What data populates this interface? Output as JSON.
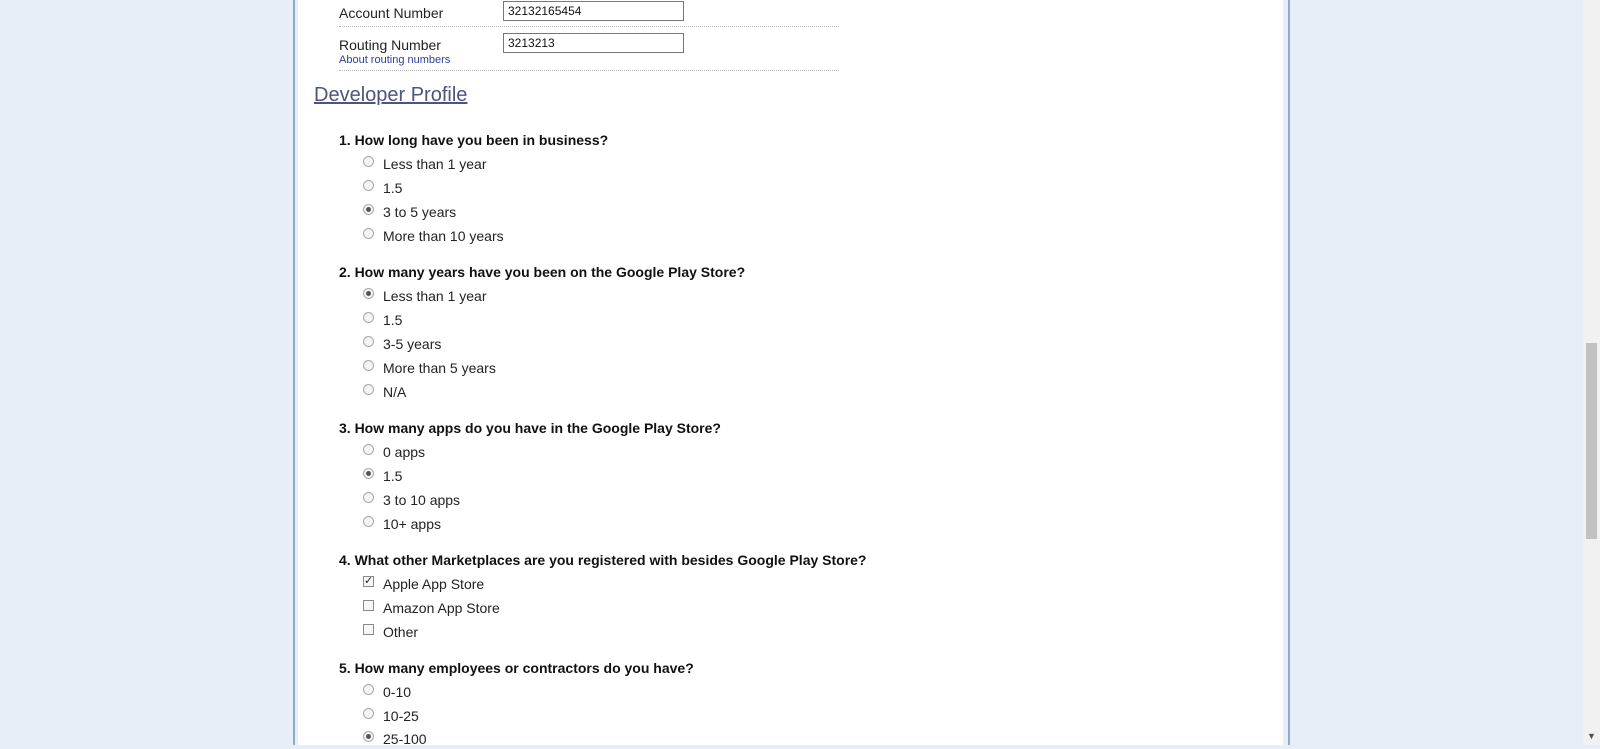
{
  "billing": {
    "account_number": {
      "label": "Account Number",
      "value": "32132165454"
    },
    "routing_number": {
      "label": "Routing Number",
      "value": "3213213",
      "help_link": "About routing numbers"
    }
  },
  "section": {
    "title": "Developer Profile"
  },
  "questions": [
    {
      "text": "1. How long have you been in business?",
      "type": "radio",
      "options": [
        {
          "label": "Less than 1 year",
          "checked": false
        },
        {
          "label": "1.5",
          "checked": false
        },
        {
          "label": "3 to 5 years",
          "checked": true
        },
        {
          "label": "More than 10 years",
          "checked": false
        }
      ]
    },
    {
      "text": "2. How many years have you been on the Google Play Store?",
      "type": "radio",
      "options": [
        {
          "label": "Less than 1 year",
          "checked": true
        },
        {
          "label": "1.5",
          "checked": false
        },
        {
          "label": "3-5 years",
          "checked": false
        },
        {
          "label": "More than 5 years",
          "checked": false
        },
        {
          "label": "N/A",
          "checked": false
        }
      ]
    },
    {
      "text": "3. How many apps do you have in the Google Play Store?",
      "type": "radio",
      "options": [
        {
          "label": "0 apps",
          "checked": false
        },
        {
          "label": "1.5",
          "checked": true
        },
        {
          "label": "3 to 10 apps",
          "checked": false
        },
        {
          "label": "10+ apps",
          "checked": false
        }
      ]
    },
    {
      "text": "4. What other Marketplaces are you registered with besides Google Play Store?",
      "type": "checkbox",
      "options": [
        {
          "label": "Apple App Store",
          "checked": true
        },
        {
          "label": "Amazon App Store",
          "checked": false
        },
        {
          "label": "Other",
          "checked": false
        }
      ]
    },
    {
      "text": "5. How many employees or contractors do you have?",
      "type": "radio",
      "options": [
        {
          "label": "0-10",
          "checked": false
        },
        {
          "label": "10-25",
          "checked": false
        },
        {
          "label": "25-100",
          "checked": true
        }
      ]
    }
  ],
  "colors": {
    "page_bg": "#e7eef8",
    "panel_border": "#8fa9cf",
    "section_title": "#4e547d",
    "link": "#2d3e9a"
  }
}
